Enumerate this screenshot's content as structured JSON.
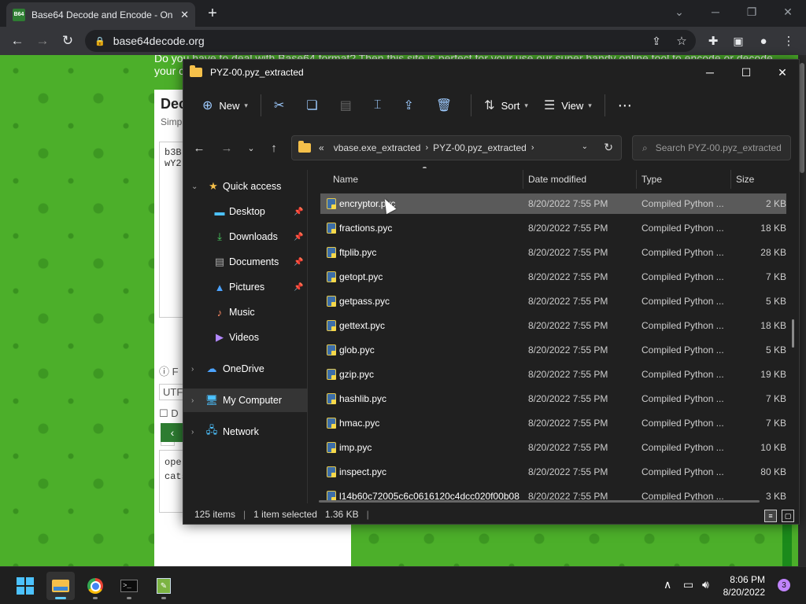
{
  "browser": {
    "tab_title": "Base64 Decode and Encode - On",
    "favicon_text": "B64",
    "url": "base64decode.org"
  },
  "website": {
    "top_line": "Do you have to deal with Base64 format? Then this site is perfect for your use our super handy online tool to encode or decode",
    "top_line2": "your c",
    "heading": "Dec",
    "subheading": "Simp",
    "input_text": "b3B\nwY2",
    "option_row_1": "F",
    "charset": "UTF",
    "option_row_2": "D",
    "option_row_3": "○",
    "output_text": "ope\ncats"
  },
  "explorer": {
    "title": "PYZ-00.pyz_extracted",
    "commands": {
      "new": "New",
      "sort": "Sort",
      "view": "View",
      "more": "⋯"
    },
    "breadcrumb": {
      "overflow": "«",
      "items": [
        "vbase.exe_extracted",
        "PYZ-00.pyz_extracted"
      ]
    },
    "search_placeholder": "Search PYZ-00.pyz_extracted",
    "nav": [
      {
        "label": "Quick access",
        "icon": "star-icon"
      },
      {
        "label": "Desktop",
        "icon": "desktop-icon"
      },
      {
        "label": "Downloads",
        "icon": "download-icon"
      },
      {
        "label": "Documents",
        "icon": "document-icon"
      },
      {
        "label": "Pictures",
        "icon": "pictures-icon"
      },
      {
        "label": "Music",
        "icon": "music-icon"
      },
      {
        "label": "Videos",
        "icon": "videos-icon"
      },
      {
        "label": "OneDrive",
        "icon": "cloud-icon"
      },
      {
        "label": "My Computer",
        "icon": "computer-icon"
      },
      {
        "label": "Network",
        "icon": "network-icon"
      }
    ],
    "columns": {
      "name": "Name",
      "date": "Date modified",
      "type": "Type",
      "size": "Size"
    },
    "files": [
      {
        "name": "encryptor.pyc",
        "date": "8/20/2022 7:55 PM",
        "type": "Compiled Python ...",
        "size": "2 KB",
        "selected": true
      },
      {
        "name": "fractions.pyc",
        "date": "8/20/2022 7:55 PM",
        "type": "Compiled Python ...",
        "size": "18 KB"
      },
      {
        "name": "ftplib.pyc",
        "date": "8/20/2022 7:55 PM",
        "type": "Compiled Python ...",
        "size": "28 KB"
      },
      {
        "name": "getopt.pyc",
        "date": "8/20/2022 7:55 PM",
        "type": "Compiled Python ...",
        "size": "7 KB"
      },
      {
        "name": "getpass.pyc",
        "date": "8/20/2022 7:55 PM",
        "type": "Compiled Python ...",
        "size": "5 KB"
      },
      {
        "name": "gettext.pyc",
        "date": "8/20/2022 7:55 PM",
        "type": "Compiled Python ...",
        "size": "18 KB"
      },
      {
        "name": "glob.pyc",
        "date": "8/20/2022 7:55 PM",
        "type": "Compiled Python ...",
        "size": "5 KB"
      },
      {
        "name": "gzip.pyc",
        "date": "8/20/2022 7:55 PM",
        "type": "Compiled Python ...",
        "size": "19 KB"
      },
      {
        "name": "hashlib.pyc",
        "date": "8/20/2022 7:55 PM",
        "type": "Compiled Python ...",
        "size": "7 KB"
      },
      {
        "name": "hmac.pyc",
        "date": "8/20/2022 7:55 PM",
        "type": "Compiled Python ...",
        "size": "7 KB"
      },
      {
        "name": "imp.pyc",
        "date": "8/20/2022 7:55 PM",
        "type": "Compiled Python ...",
        "size": "10 KB"
      },
      {
        "name": "inspect.pyc",
        "date": "8/20/2022 7:55 PM",
        "type": "Compiled Python ...",
        "size": "80 KB"
      },
      {
        "name": "l14b60c72005c6c0616120c4dcc020f00b08",
        "date": "8/20/2022 7:55 PM",
        "type": "Compiled Python ...",
        "size": "3 KB"
      }
    ],
    "status": {
      "count": "125 items",
      "selection": "1 item selected",
      "size": "1.36 KB"
    }
  },
  "taskbar": {
    "time": "8:06 PM",
    "date": "8/20/2022",
    "notification_count": "3"
  }
}
